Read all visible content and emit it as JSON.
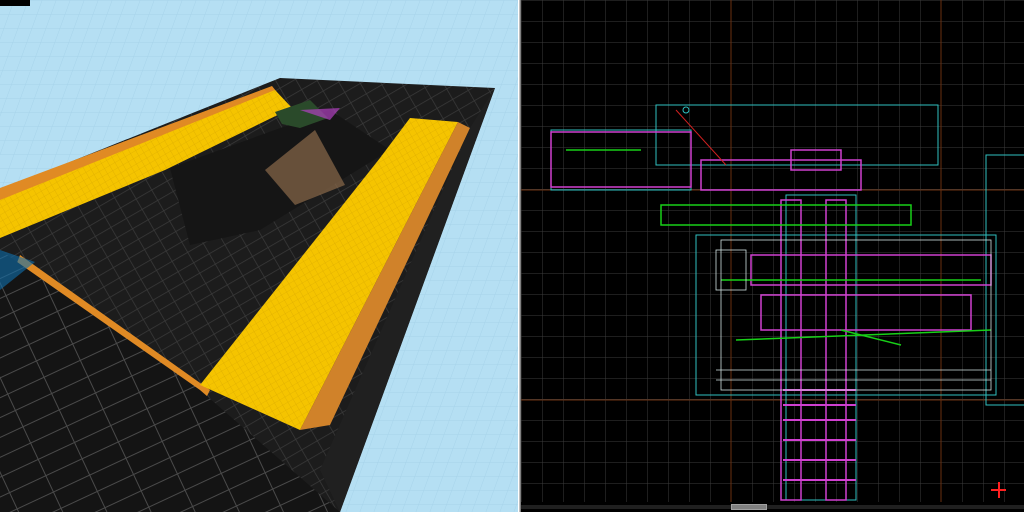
{
  "editor": {
    "views": [
      {
        "id": "3d",
        "kind": "textured-3d-camera"
      },
      {
        "id": "2d",
        "kind": "top-down-2d-grid"
      }
    ]
  },
  "colors": {
    "sky": "#b5dff3",
    "floor": "#f5c400",
    "trim": "#e08a24",
    "walls": "#1c1c1c",
    "grid": "#404040",
    "grid_major": "#5a2d10",
    "brush_magenta": "#d040d0",
    "brush_green": "#18d018",
    "brush_cyan": "#30c0c0",
    "brush_white": "#e0e0e0",
    "origin_marker": "#ff2020"
  }
}
